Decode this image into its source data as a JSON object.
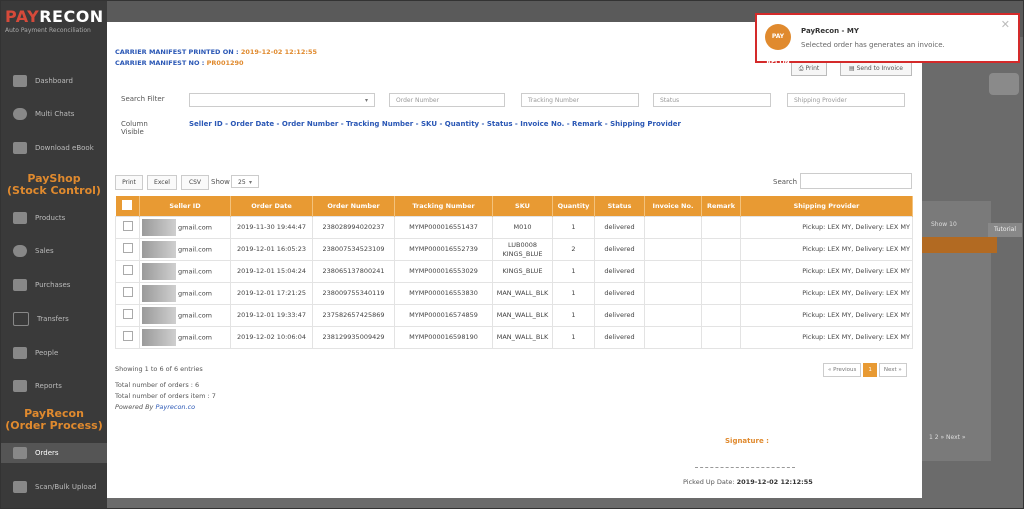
{
  "brand": {
    "name_a": "PAY",
    "name_b": "RECON",
    "tagline": "Auto Payment Reconciliation"
  },
  "sidebar": {
    "items": [
      {
        "label": "Dashboard",
        "icon": "dashboard-icon"
      },
      {
        "label": "Multi Chats",
        "icon": "chat-icon"
      },
      {
        "label": "Download eBook",
        "icon": "book-icon"
      }
    ],
    "section1": [
      "PayShop",
      "(Stock Control)"
    ],
    "items2": [
      {
        "label": "Products",
        "icon": "barcode-icon"
      },
      {
        "label": "Sales",
        "icon": "heart-icon"
      },
      {
        "label": "Purchases",
        "icon": "star-icon"
      },
      {
        "label": "Transfers",
        "icon": "star-outline-icon"
      },
      {
        "label": "People",
        "icon": "people-icon"
      },
      {
        "label": "Reports",
        "icon": "chart-icon"
      }
    ],
    "section2": [
      "PayRecon",
      "(Order Process)"
    ],
    "items3": [
      {
        "label": "Orders",
        "icon": "orders-icon"
      },
      {
        "label": "Scan/Bulk Upload",
        "icon": "upload-icon"
      }
    ]
  },
  "modal": {
    "printed_on_label": "CARRIER MANIFEST PRINTED ON : ",
    "printed_on": "2019-12-02 12:12:55",
    "manifest_no_label": "CARRIER MANIFEST NO : ",
    "manifest_no": "PR001290",
    "print_btn": "Print",
    "send_invoice_btn": "Send to Invoice",
    "search_filter_label": "Search Filter",
    "column_visible_label": "Column Visible",
    "filters": {
      "order_number": "Order Number",
      "tracking_number": "Tracking Number",
      "status": "Status",
      "shipping_provider": "Shipping Provider"
    },
    "column_links": "Seller ID - Order Date - Order Number - Tracking Number - SKU - Quantity - Status - Invoice No. - Remark - Shipping Provider",
    "tools": {
      "print": "Print",
      "excel": "Excel",
      "csv": "CSV",
      "show": "Show",
      "show_val": "25",
      "search": "Search"
    },
    "columns": [
      "Seller ID",
      "Order Date",
      "Order Number",
      "Tracking Number",
      "SKU",
      "Quantity",
      "Status",
      "Invoice No.",
      "Remark",
      "Shipping Provider"
    ],
    "rows": [
      {
        "seller": "gmail.com",
        "date": "2019-11-30 19:44:47",
        "order": "238028994020237",
        "tracking": "MYMP000016551437",
        "sku": "M010",
        "qty": "1",
        "status": "delivered",
        "invoice": "",
        "remark": "",
        "provider": "Pickup: LEX MY, Delivery: LEX MY"
      },
      {
        "seller": "gmail.com",
        "date": "2019-12-01 16:05:23",
        "order": "238007534523109",
        "tracking": "MYMP000016552739",
        "sku": "LUB0008 KINGS_BLUE",
        "qty": "2",
        "status": "delivered",
        "invoice": "",
        "remark": "",
        "provider": "Pickup: LEX MY, Delivery: LEX MY"
      },
      {
        "seller": "gmail.com",
        "date": "2019-12-01 15:04:24",
        "order": "238065137800241",
        "tracking": "MYMP000016553029",
        "sku": "KINGS_BLUE",
        "qty": "1",
        "status": "delivered",
        "invoice": "",
        "remark": "",
        "provider": "Pickup: LEX MY, Delivery: LEX MY"
      },
      {
        "seller": "gmail.com",
        "date": "2019-12-01 17:21:25",
        "order": "238009755340119",
        "tracking": "MYMP000016553830",
        "sku": "MAN_WALL_BLK",
        "qty": "1",
        "status": "delivered",
        "invoice": "",
        "remark": "",
        "provider": "Pickup: LEX MY, Delivery: LEX MY"
      },
      {
        "seller": "gmail.com",
        "date": "2019-12-01 19:33:47",
        "order": "237582657425869",
        "tracking": "MYMP000016574859",
        "sku": "MAN_WALL_BLK",
        "qty": "1",
        "status": "delivered",
        "invoice": "",
        "remark": "",
        "provider": "Pickup: LEX MY, Delivery: LEX MY"
      },
      {
        "seller": "gmail.com",
        "date": "2019-12-02 10:06:04",
        "order": "238129935009429",
        "tracking": "MYMP000016598190",
        "sku": "MAN_WALL_BLK",
        "qty": "1",
        "status": "delivered",
        "invoice": "",
        "remark": "",
        "provider": "Pickup: LEX MY, Delivery: LEX MY"
      }
    ],
    "showing": "Showing 1 to 6 of 6 entries",
    "total_orders": "Total number of orders : 6",
    "total_items": "Total number of orders item : 7",
    "powered_by": "Powered By ",
    "powered_link": "Payrecon.co",
    "pager": {
      "prev": "« Previous",
      "page": "1",
      "next": "Next »"
    },
    "signature": "Signature :",
    "picked_label": "Picked Up Date: ",
    "picked_date": "2019-12-02 12:12:55"
  },
  "toast": {
    "logo": "PAY RECON",
    "title": "PayRecon - MY",
    "message": "Selected order has generates an invoice."
  },
  "background": {
    "show": "Show",
    "show_val": "10",
    "tutorial": "Tutorial",
    "pager": "1  2  »  Next »"
  },
  "colors": {
    "accent": "#e89a33",
    "link": "#2a57b5",
    "toast_border": "#d42a2a"
  }
}
